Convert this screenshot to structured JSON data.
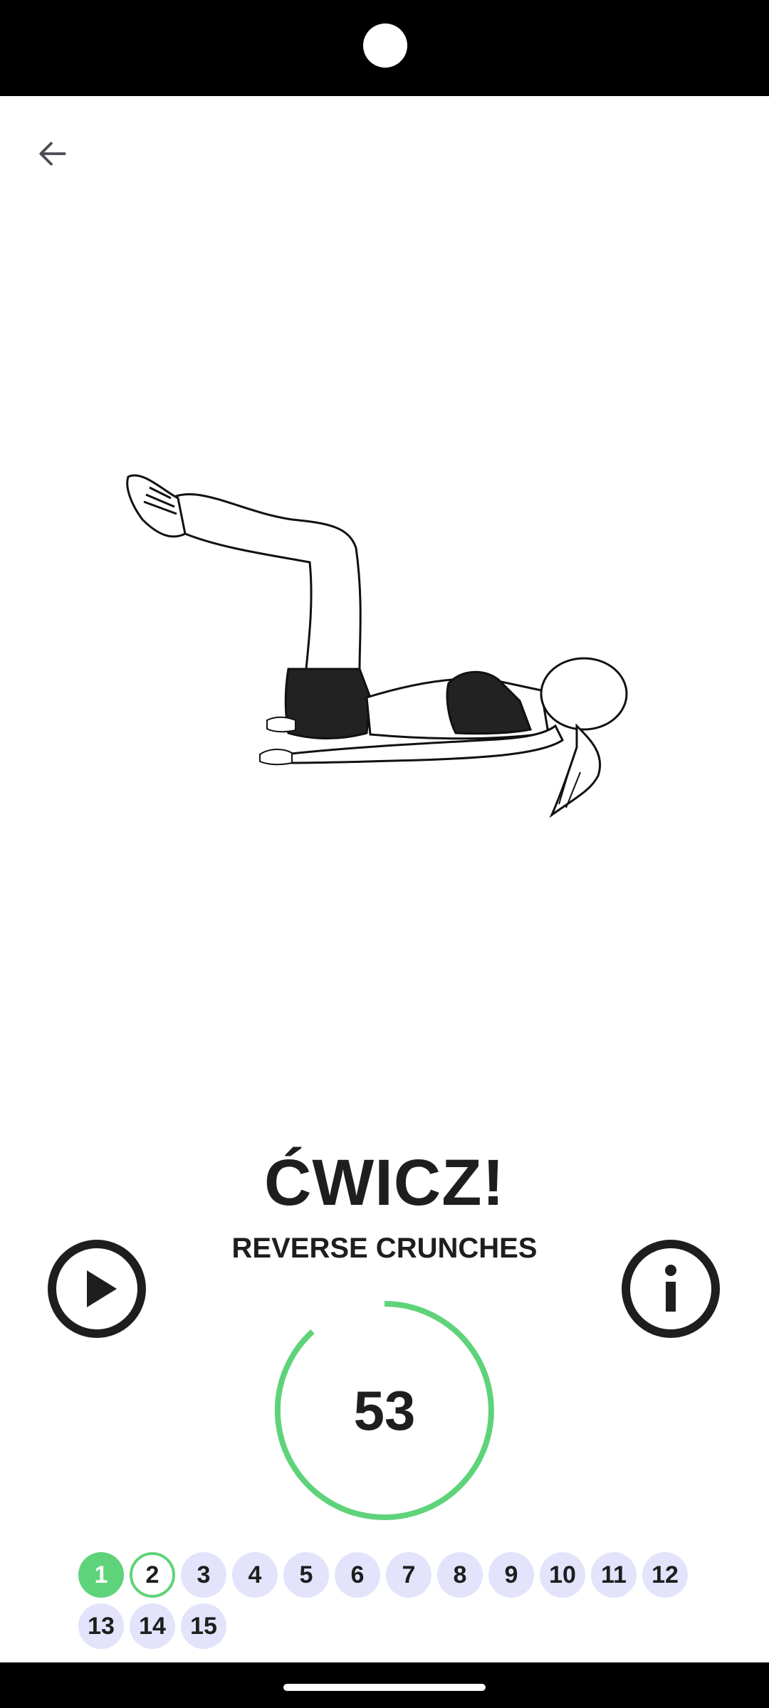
{
  "header": {
    "back_icon": "arrow-left-icon"
  },
  "exercise": {
    "title": "ĆWICZ!",
    "name": "REVERSE CRUNCHES"
  },
  "controls": {
    "play_icon": "play-icon",
    "info_icon": "info-icon"
  },
  "timer": {
    "value": "53",
    "color": "#5fd37a"
  },
  "steps": {
    "items": [
      "1",
      "2",
      "3",
      "4",
      "5",
      "6",
      "7",
      "8",
      "9",
      "10",
      "11",
      "12",
      "13",
      "14",
      "15"
    ],
    "completed_color": "#5fd37a",
    "pending_color": "#e3e3fb"
  }
}
